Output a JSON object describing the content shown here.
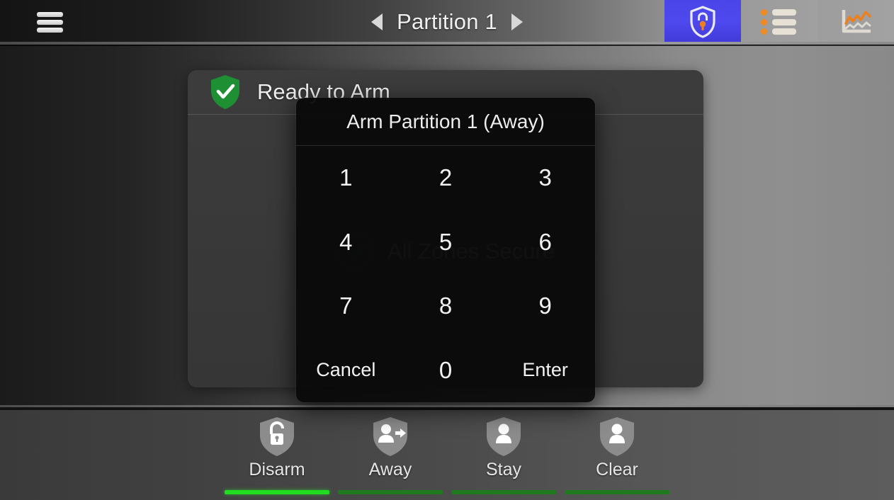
{
  "header": {
    "menu_icon": "hamburger-menu-icon",
    "prev_arrow": "◀",
    "next_arrow": "▶",
    "partition_label": "Partition 1",
    "tabs": [
      {
        "name": "security",
        "icon": "shield-lock-icon",
        "active": true
      },
      {
        "name": "zones-list",
        "icon": "list-icon",
        "active": false
      },
      {
        "name": "history-chart",
        "icon": "chart-icon",
        "active": false
      }
    ],
    "accent_active": "#4a45e8",
    "accent_orange": "#ef8b22"
  },
  "status": {
    "shield_icon": "green-shield-check-icon",
    "title": "Ready to Arm",
    "zones_icon": "circle-check-icon",
    "zones_text": "All Zones Secure",
    "ready_color": "#1f8f33"
  },
  "keypad": {
    "title": "Arm Partition 1 (Away)",
    "keys": [
      {
        "label": "1",
        "type": "digit"
      },
      {
        "label": "2",
        "type": "digit"
      },
      {
        "label": "3",
        "type": "digit"
      },
      {
        "label": "4",
        "type": "digit"
      },
      {
        "label": "5",
        "type": "digit"
      },
      {
        "label": "6",
        "type": "digit"
      },
      {
        "label": "7",
        "type": "digit"
      },
      {
        "label": "8",
        "type": "digit"
      },
      {
        "label": "9",
        "type": "digit"
      },
      {
        "label": "Cancel",
        "type": "action"
      },
      {
        "label": "0",
        "type": "digit"
      },
      {
        "label": "Enter",
        "type": "action"
      }
    ],
    "entered_code": ""
  },
  "toolbar": {
    "buttons": [
      {
        "label": "Disarm",
        "icon": "shield-unlocked-padlock-icon",
        "active": true
      },
      {
        "label": "Away",
        "icon": "shield-person-arrow-icon",
        "active": false
      },
      {
        "label": "Stay",
        "icon": "shield-person-icon",
        "active": false
      },
      {
        "label": "Clear",
        "icon": "shield-person-icon",
        "active": false
      }
    ],
    "bar_active_color": "#21dd21",
    "bar_idle_color": "#1f7a1f"
  }
}
